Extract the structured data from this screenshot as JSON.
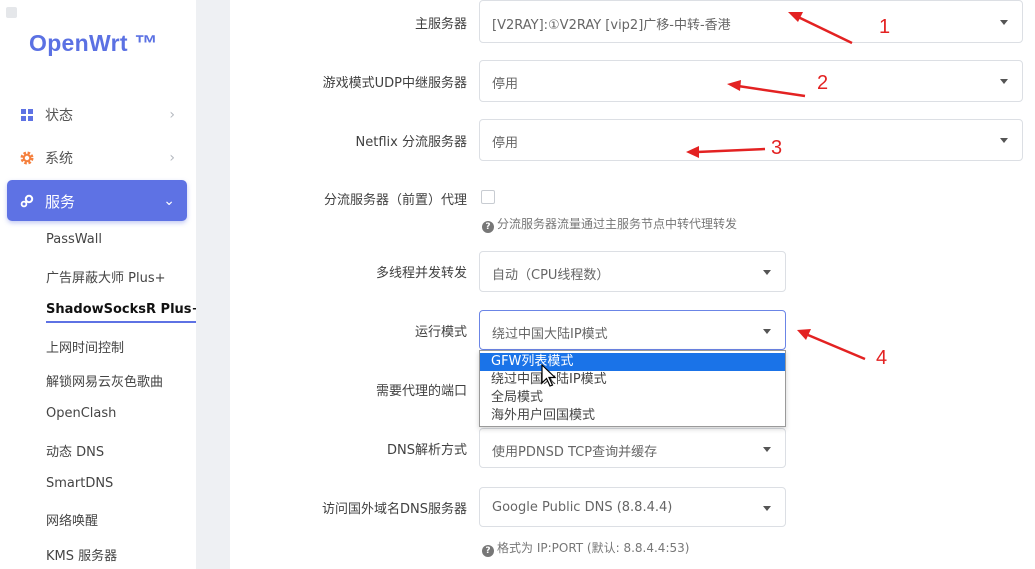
{
  "sidebar": {
    "logo": "OpenWrt ™",
    "nav": [
      {
        "label": "状态",
        "icon": "dashboard-icon",
        "chevron": "›"
      },
      {
        "label": "系统",
        "icon": "gear-icon",
        "chevron": "›"
      },
      {
        "label": "服务",
        "icon": "services-icon",
        "chevron": "⌄"
      }
    ],
    "sub_items": [
      "PassWall",
      "广告屏蔽大师 Plus+",
      "ShadowSocksR Plus+",
      "上网时间控制",
      "解锁网易云灰色歌曲",
      "OpenClash",
      "动态 DNS",
      "SmartDNS",
      "网络唤醒",
      "KMS 服务器"
    ],
    "active_sub_index": 2
  },
  "form": {
    "main_server": {
      "label": "主服务器",
      "value": "[V2RAY]:①V2RAY [vip2]广移-中转-香港"
    },
    "udp_server": {
      "label": "游戏模式UDP中继服务器",
      "value": "停用"
    },
    "netflix_server": {
      "label": "Netflix 分流服务器",
      "value": "停用"
    },
    "shunt_proxy": {
      "label": "分流服务器（前置）代理",
      "checked": false,
      "hint": "分流服务器流量通过主服务节点中转代理转发"
    },
    "threads": {
      "label": "多线程并发转发",
      "value": "自动（CPU线程数）"
    },
    "run_mode": {
      "label": "运行模式",
      "value": "绕过中国大陆IP模式",
      "options": [
        "GFW列表模式",
        "绕过中国大陆IP模式",
        "全局模式",
        "海外用户回国模式"
      ],
      "highlighted_index": 0
    },
    "proxy_ports": {
      "label": "需要代理的端口"
    },
    "dns_mode": {
      "label": "DNS解析方式",
      "value": "使用PDNSD TCP查询并缓存"
    },
    "foreign_dns": {
      "label": "访问国外域名DNS服务器",
      "value": "Google Public DNS (8.8.4.4)",
      "hint": "格式为 IP:PORT (默认: 8.8.4.4:53)"
    }
  },
  "annotations": [
    "1",
    "2",
    "3",
    "4"
  ],
  "colors": {
    "accent": "#5e72e4",
    "annotation": "#e32222",
    "dropdown_highlight": "#1a73e8"
  }
}
